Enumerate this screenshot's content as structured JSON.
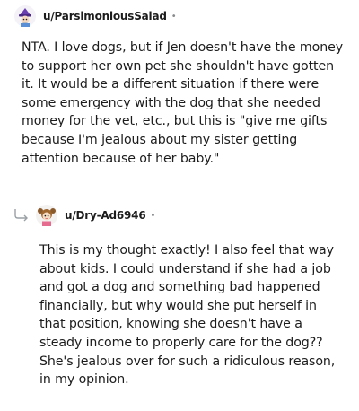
{
  "comments": [
    {
      "username": "u/ParsimoniousSalad",
      "separator": "•",
      "avatar_icon": "avatar-wizard-icon",
      "body": "NTA. I love dogs, but if Jen doesn't have the money to support her own pet she shouldn't have gotten it. It would be a different situation if there were some emergency with the dog that she needed money for the vet, etc., but this is \"give me gifts because I'm jealous about my sister getting attention because of her baby.\""
    },
    {
      "username": "u/Dry-Ad6946",
      "separator": "•",
      "avatar_icon": "avatar-pigtails-icon",
      "reply_icon": "reply-arrow-icon",
      "body": "This is my thought exactly! I also feel that way about kids. I could understand if she had a job and got a dog and something bad happened financially, but why would she put herself in that position, knowing she doesn't have a steady income to properly care for the dog?? She's jealous over for such a ridiculous reason, in my opinion."
    }
  ],
  "colors": {
    "text": "#1c1c1c",
    "meta": "#878a8c",
    "accent_purple": "#7b3fb8"
  }
}
